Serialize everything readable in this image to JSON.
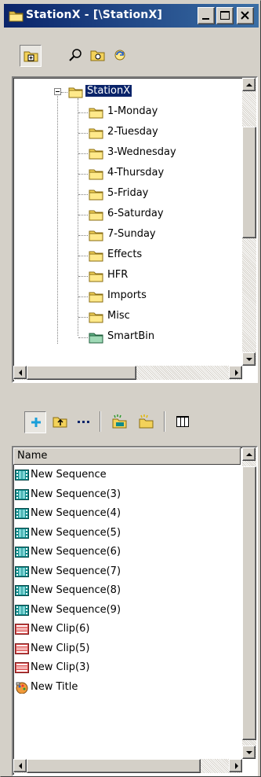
{
  "window": {
    "title": "StationX - [\\StationX]",
    "title_icon": "folder-icon",
    "minimize_icon": "minimize-icon",
    "maximize_icon": "maximize-icon",
    "close_icon": "close-icon"
  },
  "toolbar_top": {
    "buttons": [
      {
        "icon": "tree-view-icon",
        "pressed": true
      },
      {
        "icon": "find-icon",
        "pressed": false
      },
      {
        "icon": "browse-folder-icon",
        "pressed": false
      },
      {
        "icon": "refresh-icon",
        "pressed": false
      }
    ]
  },
  "tree": {
    "root": {
      "label": "StationX",
      "selected": true,
      "expanded": true
    },
    "children": [
      {
        "label": "1-Monday",
        "icon": "folder-icon"
      },
      {
        "label": "2-Tuesday",
        "icon": "folder-icon"
      },
      {
        "label": "3-Wednesday",
        "icon": "folder-icon"
      },
      {
        "label": "4-Thursday",
        "icon": "folder-icon"
      },
      {
        "label": "5-Friday",
        "icon": "folder-icon"
      },
      {
        "label": "6-Saturday",
        "icon": "folder-icon"
      },
      {
        "label": "7-Sunday",
        "icon": "folder-icon"
      },
      {
        "label": "Effects",
        "icon": "folder-icon"
      },
      {
        "label": "HFR",
        "icon": "folder-icon"
      },
      {
        "label": "Imports",
        "icon": "folder-icon"
      },
      {
        "label": "Misc",
        "icon": "folder-icon"
      },
      {
        "label": "SmartBin",
        "icon": "smartbin-icon"
      }
    ]
  },
  "toolbar_list": {
    "buttons": [
      {
        "icon": "new-item-icon",
        "pressed": true
      },
      {
        "icon": "up-folder-icon"
      },
      {
        "icon": "more-icon"
      },
      {
        "icon": "new-sequence-folder-icon"
      },
      {
        "icon": "new-folder-icon"
      },
      {
        "icon": "columns-icon"
      }
    ]
  },
  "list": {
    "column_header": "Name",
    "items": [
      {
        "label": "New Sequence",
        "type": "sequence"
      },
      {
        "label": "New Sequence(3)",
        "type": "sequence"
      },
      {
        "label": "New Sequence(4)",
        "type": "sequence"
      },
      {
        "label": "New Sequence(5)",
        "type": "sequence"
      },
      {
        "label": "New Sequence(6)",
        "type": "sequence"
      },
      {
        "label": "New Sequence(7)",
        "type": "sequence"
      },
      {
        "label": "New Sequence(8)",
        "type": "sequence"
      },
      {
        "label": "New Sequence(9)",
        "type": "sequence"
      },
      {
        "label": "New Clip(6)",
        "type": "clip"
      },
      {
        "label": "New Clip(5)",
        "type": "clip"
      },
      {
        "label": "New Clip(3)",
        "type": "clip"
      },
      {
        "label": "New Title",
        "type": "title"
      }
    ]
  },
  "colors": {
    "titlebar_start": "#0a246a",
    "titlebar_end": "#3a6ea5",
    "selection": "#0a246a",
    "face": "#d4d0c8",
    "folder": "#f3d25a",
    "sequence": "#0f8a8a",
    "clip": "#d94b4b"
  }
}
